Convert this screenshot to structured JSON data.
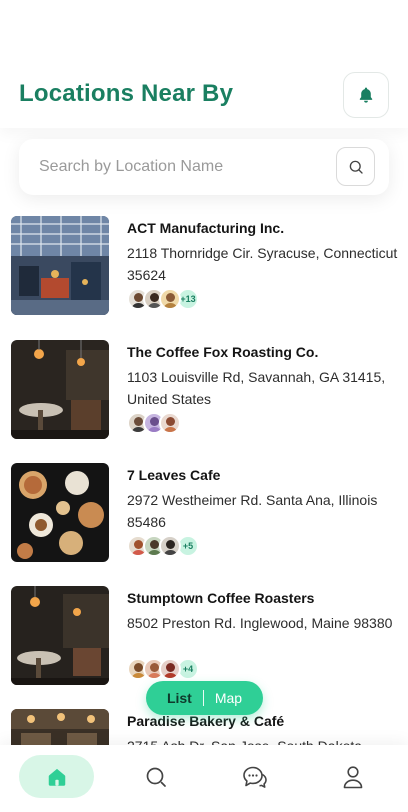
{
  "header": {
    "title": "Locations Near By",
    "bell_icon": "bell-icon"
  },
  "search": {
    "placeholder": "Search by Location Name",
    "icon": "search-icon"
  },
  "colors": {
    "brand": "#1a7f61",
    "accent": "#2fcf96",
    "accent_light": "#d8f6e7"
  },
  "locations": [
    {
      "name": "ACT Manufacturing Inc.",
      "address": "2118 Thornridge Cir. Syracuse, Connecticut 35624",
      "extra_count": "+13"
    },
    {
      "name": "The Coffee Fox Roasting Co.",
      "address": "1103 Louisville Rd, Savannah, GA 31415, United States",
      "extra_count": ""
    },
    {
      "name": "7 Leaves Cafe",
      "address": "2972 Westheimer Rd. Santa Ana, Illinois 85486",
      "extra_count": "+5"
    },
    {
      "name": "Stumptown Coffee Roasters",
      "address": "8502 Preston Rd. Inglewood, Maine 98380",
      "extra_count": "+4"
    },
    {
      "name": "Paradise Bakery & Café",
      "address": "2715 Ash Dr. San Jose, South Dakota",
      "extra_count": ""
    }
  ],
  "view_toggle": {
    "list_label": "List",
    "map_label": "Map",
    "selected": "List"
  },
  "bottom_nav": [
    {
      "icon": "home-icon",
      "active": true
    },
    {
      "icon": "search-icon",
      "active": false
    },
    {
      "icon": "chat-icon",
      "active": false
    },
    {
      "icon": "profile-icon",
      "active": false
    }
  ]
}
